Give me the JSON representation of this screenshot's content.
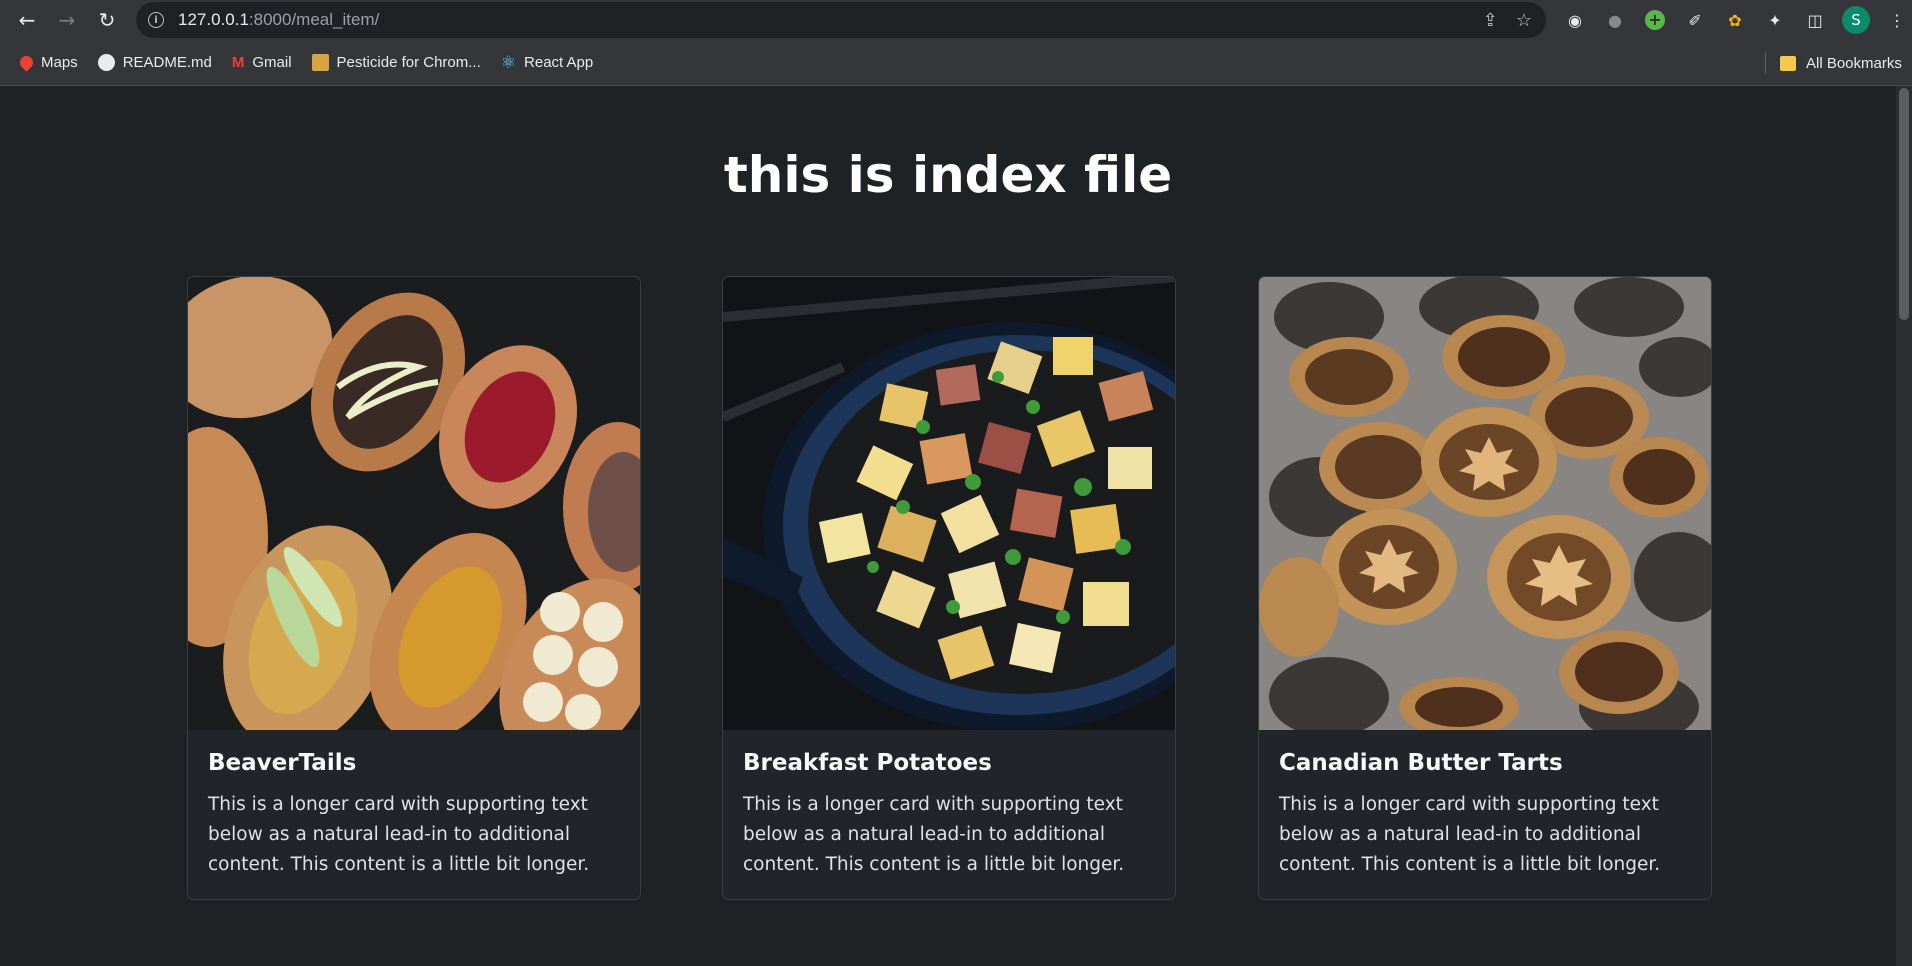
{
  "browser": {
    "url_host": "127.0.0.1",
    "url_path": ":8000/meal_item/",
    "profile_initial": "S"
  },
  "bookmarks": [
    {
      "label": "Maps",
      "icon": "maps-pin-icon",
      "color": "#ea4335"
    },
    {
      "label": "README.md",
      "icon": "github-icon",
      "color": "#e8eaed"
    },
    {
      "label": "Gmail",
      "icon": "gmail-icon",
      "color": "#ea4335"
    },
    {
      "label": "Pesticide for Chrom...",
      "icon": "pesticide-icon",
      "color": "#d9a441"
    },
    {
      "label": "React App",
      "icon": "react-icon",
      "color": "#61dafb"
    }
  ],
  "all_bookmarks_label": "All Bookmarks",
  "page": {
    "title": "this is index file"
  },
  "cards": [
    {
      "title": "BeaverTails",
      "text": "This is a longer card with supporting text below as a natural lead-in to additional content. This content is a little bit longer.",
      "image": "beavertails-photo"
    },
    {
      "title": "Breakfast Potatoes",
      "text": "This is a longer card with supporting text below as a natural lead-in to additional content. This content is a little bit longer.",
      "image": "breakfast-potatoes-photo"
    },
    {
      "title": "Canadian Butter Tarts",
      "text": "This is a longer card with supporting text below as a natural lead-in to additional content. This content is a little bit longer.",
      "image": "butter-tarts-photo"
    }
  ]
}
